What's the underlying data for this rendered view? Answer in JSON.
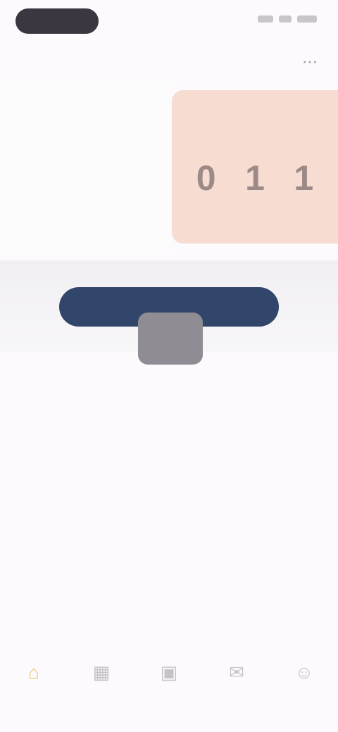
{
  "status_bar": {
    "time": ""
  },
  "header": {
    "title": "",
    "action_icon": "more-icon"
  },
  "info": {
    "label": "",
    "sub": ""
  },
  "timer": {
    "title": "",
    "digits": [
      "0",
      "1",
      "1"
    ],
    "units": [
      "",
      "",
      ""
    ]
  },
  "primary_button": {
    "label": ""
  },
  "tooltip": {
    "text": ""
  },
  "tabs": [
    {
      "label": "",
      "icon": "home-icon",
      "active": true
    },
    {
      "label": "",
      "icon": "grid-icon",
      "active": false
    },
    {
      "label": "",
      "icon": "calendar-icon",
      "active": false
    },
    {
      "label": "",
      "icon": "message-icon",
      "active": false
    },
    {
      "label": "",
      "icon": "user-icon",
      "active": false
    }
  ],
  "colors": {
    "background": "#fcfafc",
    "accent_button": "#32466b",
    "timer_panel": "#f7dcd2",
    "active_tab": "#e8c66b"
  }
}
